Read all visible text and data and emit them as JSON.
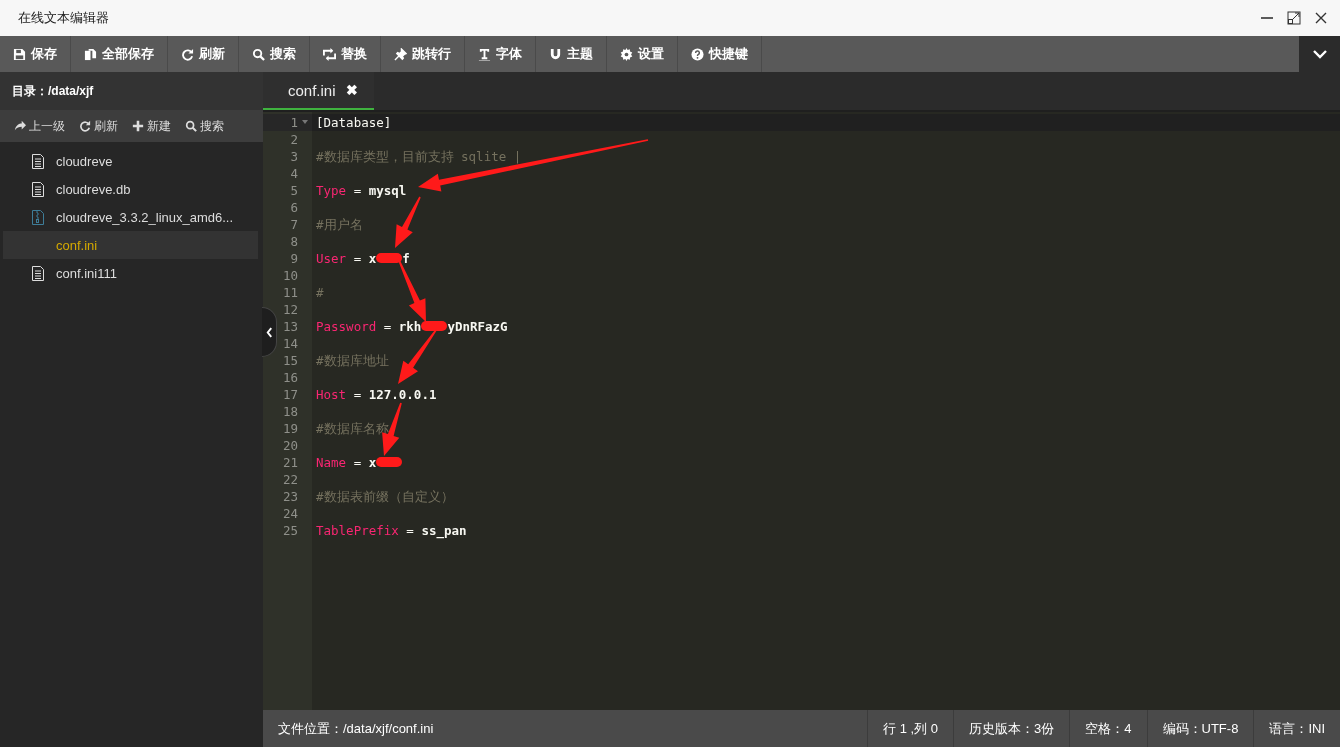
{
  "window": {
    "title": "在线文本编辑器"
  },
  "toolbar": [
    {
      "label": "保存"
    },
    {
      "label": "全部保存"
    },
    {
      "label": "刷新"
    },
    {
      "label": "搜索"
    },
    {
      "label": "替换"
    },
    {
      "label": "跳转行"
    },
    {
      "label": "字体"
    },
    {
      "label": "主题"
    },
    {
      "label": "设置"
    },
    {
      "label": "快捷键"
    }
  ],
  "sidebar": {
    "path": "目录：/data/xjf",
    "actions": [
      {
        "label": "上一级"
      },
      {
        "label": "刷新"
      },
      {
        "label": "新建"
      },
      {
        "label": "搜索"
      }
    ],
    "items": [
      {
        "name": "cloudreve",
        "kind": "file",
        "selected": false
      },
      {
        "name": "cloudreve.db",
        "kind": "file",
        "selected": false
      },
      {
        "name": "cloudreve_3.3.2_linux_amd6...",
        "kind": "archive",
        "selected": false
      },
      {
        "name": "conf.ini",
        "kind": "plain",
        "selected": true
      },
      {
        "name": "conf.ini111",
        "kind": "file",
        "selected": false
      }
    ]
  },
  "tabs": [
    {
      "label": "conf.ini",
      "close": "✖",
      "selected": true
    }
  ],
  "editor": {
    "lines": [
      {
        "number": "1",
        "kind": "section",
        "text": "[Database]",
        "fold": true,
        "current": true
      },
      {
        "number": "2",
        "kind": "blank"
      },
      {
        "number": "3",
        "kind": "comment",
        "text": "#数据库类型，目前支持 sqlite |"
      },
      {
        "number": "4",
        "kind": "blank"
      },
      {
        "number": "5",
        "kind": "pair",
        "key": "Type",
        "eq": "=",
        "value": [
          {
            "kind": "text",
            "text": "mysql"
          }
        ]
      },
      {
        "number": "6",
        "kind": "blank"
      },
      {
        "number": "7",
        "kind": "comment",
        "text": "#用户名"
      },
      {
        "number": "8",
        "kind": "blank"
      },
      {
        "number": "9",
        "kind": "pair",
        "key": "User",
        "eq": "=",
        "value": [
          {
            "kind": "text",
            "text": "x"
          },
          {
            "kind": "scribble"
          },
          {
            "kind": "text",
            "text": "f"
          }
        ]
      },
      {
        "number": "10",
        "kind": "blank"
      },
      {
        "number": "11",
        "kind": "comment",
        "text": "#"
      },
      {
        "number": "12",
        "kind": "blank"
      },
      {
        "number": "13",
        "kind": "pair",
        "key": "Password",
        "eq": "=",
        "value": [
          {
            "kind": "text",
            "text": "rkh"
          },
          {
            "kind": "scribble"
          },
          {
            "kind": "text",
            "text": "yDnRFazG"
          }
        ]
      },
      {
        "number": "14",
        "kind": "blank"
      },
      {
        "number": "15",
        "kind": "comment",
        "text": "#数据库地址"
      },
      {
        "number": "16",
        "kind": "blank"
      },
      {
        "number": "17",
        "kind": "pair",
        "key": "Host",
        "eq": "=",
        "value": [
          {
            "kind": "text",
            "text": "127.0.0.1"
          }
        ]
      },
      {
        "number": "18",
        "kind": "blank"
      },
      {
        "number": "19",
        "kind": "comment",
        "text": "#数据库名称"
      },
      {
        "number": "20",
        "kind": "blank"
      },
      {
        "number": "21",
        "kind": "pair",
        "key": "Name",
        "eq": "=",
        "value": [
          {
            "kind": "text",
            "text": "x"
          },
          {
            "kind": "scribble"
          }
        ]
      },
      {
        "number": "22",
        "kind": "blank"
      },
      {
        "number": "23",
        "kind": "comment",
        "text": "#数据表前缀（自定义）"
      },
      {
        "number": "24",
        "kind": "blank"
      },
      {
        "number": "25",
        "kind": "pair",
        "key": "TablePrefix",
        "eq": "=",
        "value": [
          {
            "kind": "text",
            "text": "ss_pan"
          }
        ]
      }
    ]
  },
  "status_bar": {
    "location": "文件位置：/data/xjf/conf.ini",
    "items": [
      {
        "text": "行 1 ,列 0"
      },
      {
        "text": "历史版本：3份"
      },
      {
        "text": "空格：4"
      },
      {
        "text": "编码：UTF-8"
      },
      {
        "text": "语言：INI"
      }
    ]
  }
}
